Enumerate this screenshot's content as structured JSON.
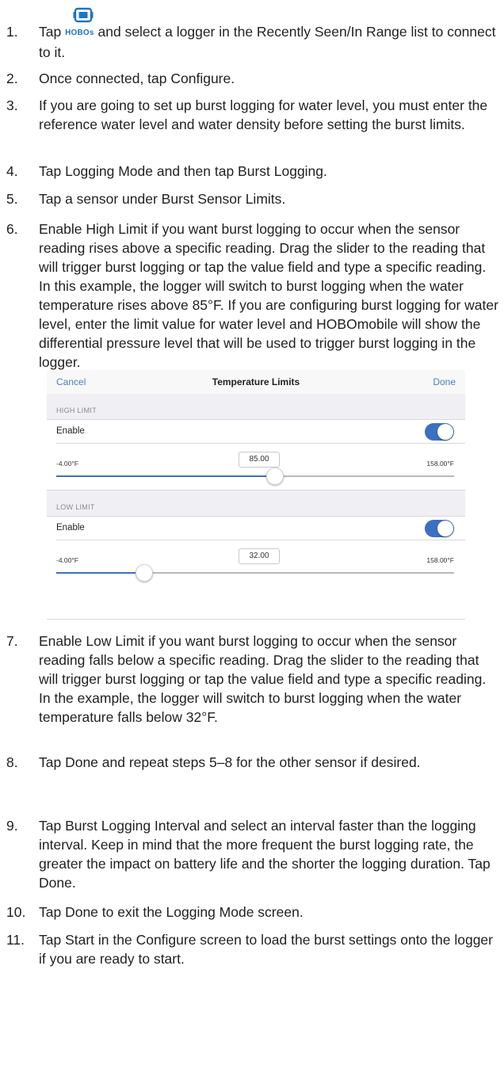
{
  "steps": [
    {
      "num": "1.",
      "pre": "Tap ",
      "icon_label": "HOBOs",
      "post": " and select a logger in the Recently Seen/In Range list to connect to it."
    },
    {
      "num": "2.",
      "text": "Once connected, tap Configure."
    },
    {
      "num": "3.",
      "text": "If you are going to set up burst logging for water level, you must enter the reference water level and water density before setting the burst limits."
    },
    {
      "num": "4.",
      "text": "Tap Logging Mode and then tap Burst Logging."
    },
    {
      "num": "5.",
      "text": "Tap a sensor under Burst Sensor Limits."
    },
    {
      "num": "6.",
      "text": "Enable High Limit if you want burst logging to occur when the sensor reading rises above a specific reading. Drag the slider to the reading that will trigger burst logging or tap the value field and type a specific reading. In this example, the logger will switch to burst logging when the water temperature rises above 85°F. If you are configuring burst logging for water level, enter the limit value for water level and HOBOmobile will show the differential pressure level that will be used to trigger burst logging in the logger."
    },
    {
      "num": "7.",
      "text": "Enable Low Limit if you want burst logging to occur when the sensor reading falls below a specific reading. Drag the slider to the reading that will trigger burst logging or tap the value field and type a specific reading. In the example, the logger will switch to burst logging when the water temperature falls below 32°F."
    },
    {
      "num": "8.",
      "text": "Tap Done and repeat steps 5–8 for the other sensor if desired."
    },
    {
      "num": "9.",
      "text": "Tap Burst Logging Interval and select an interval faster than the logging interval. Keep in mind that the more frequent the burst logging rate, the greater the impact on battery life and the shorter the logging duration. Tap Done."
    },
    {
      "num": "10.",
      "text": "Tap Done to exit the Logging Mode screen."
    },
    {
      "num": "11.",
      "text": "Tap Start in the Configure screen to load the burst settings onto the logger if you are ready to start."
    }
  ],
  "screenshot": {
    "cancel": "Cancel",
    "title": "Temperature Limits",
    "done": "Done",
    "high": {
      "section": "HIGH LIMIT",
      "enable": "Enable",
      "enabled": true,
      "min": "-4.00°F",
      "max": "158.00°F",
      "value": "85.00",
      "slider_fraction": 0.549
    },
    "low": {
      "section": "LOW LIMIT",
      "enable": "Enable",
      "enabled": true,
      "min": "-4.00°F",
      "max": "158.00°F",
      "value": "32.00",
      "slider_fraction": 0.222
    }
  },
  "colors": {
    "accent": "#3c70bf",
    "hobos_blue": "#1e74c2",
    "text": "#231f20",
    "section_bg": "#efeff4"
  }
}
